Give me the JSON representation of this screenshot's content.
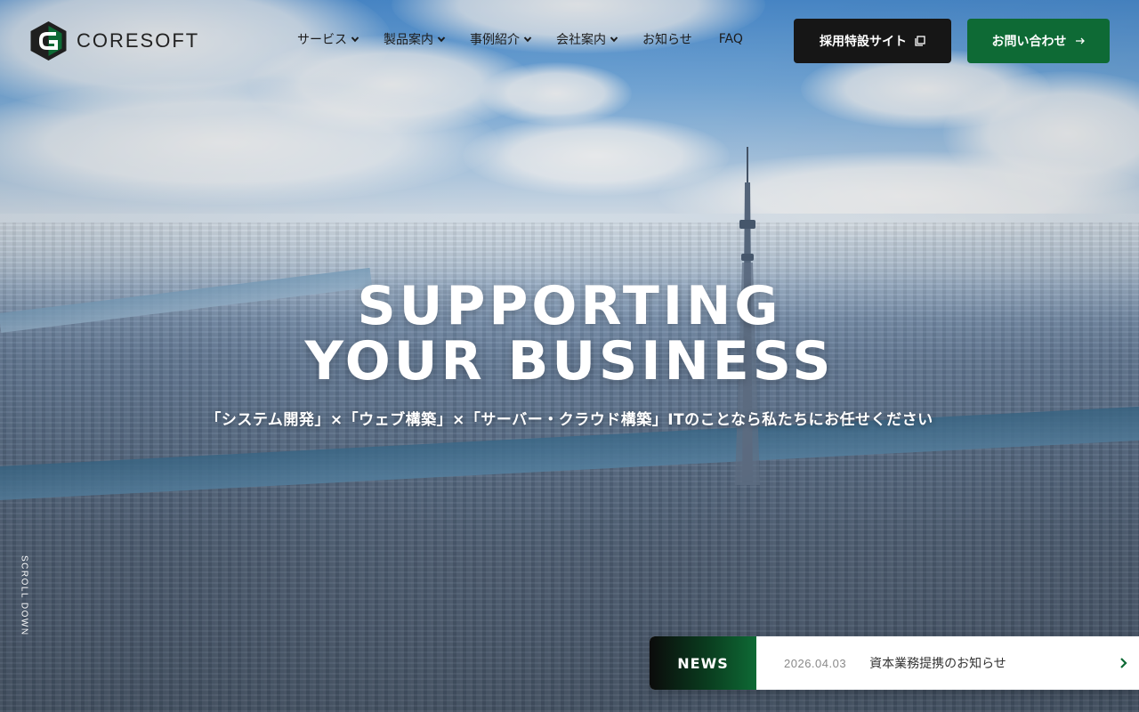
{
  "brand": {
    "name": "CORESOFT",
    "accent": "#0e6a35",
    "dark": "#161616"
  },
  "nav": {
    "items": [
      {
        "label": "サービス",
        "dropdown": true
      },
      {
        "label": "製品案内",
        "dropdown": true
      },
      {
        "label": "事例紹介",
        "dropdown": true
      },
      {
        "label": "会社案内",
        "dropdown": true
      },
      {
        "label": "お知らせ",
        "dropdown": false
      },
      {
        "label": "FAQ",
        "dropdown": false
      }
    ]
  },
  "buttons": {
    "recruit_label": "採用特設サイト",
    "recruit_icon": "external-window-icon",
    "contact_label": "お問い合わせ",
    "contact_icon": "arrow-right-icon"
  },
  "hero": {
    "title_line1": "SUPPORTING",
    "title_line2": "YOUR BUSINESS",
    "subtitle": "「システム開発」×「ウェブ構築」×「サーバー・クラウド構築」ITのことなら私たちにお任せください"
  },
  "scroll": {
    "label": "SCROLL DOWN"
  },
  "news": {
    "label": "NEWS",
    "date": "2026.04.03",
    "title": "資本業務提携のお知らせ",
    "arrow_icon": "chevron-right-icon"
  }
}
